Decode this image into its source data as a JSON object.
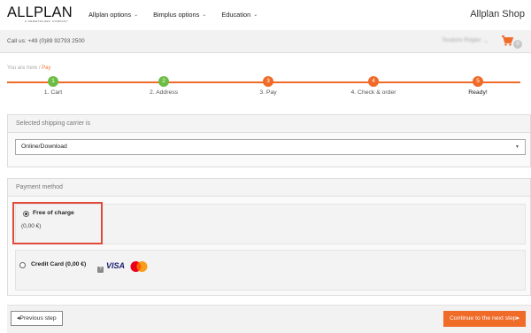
{
  "brand": {
    "logo": "ALLPLAN",
    "logo_sub": "A NEMETSCHEK COMPANY",
    "shop_title": "Allplan Shop"
  },
  "nav": [
    {
      "label": "Allplan options"
    },
    {
      "label": "Bimplus options"
    },
    {
      "label": "Education"
    }
  ],
  "callbar": {
    "call_text": "Call us: +49 (0)89 92793 2500",
    "user_name": "Teodore Rögler",
    "cart_count": "0"
  },
  "breadcrumb": {
    "prefix": "You are here",
    "separator": "/",
    "current": "Pay"
  },
  "steps": [
    {
      "number": "1",
      "label": "1. Cart",
      "state": "done"
    },
    {
      "number": "2",
      "label": "2. Address",
      "state": "done"
    },
    {
      "number": "3",
      "label": "3. Pay",
      "state": "active"
    },
    {
      "number": "4",
      "label": "4. Check & order",
      "state": "todo"
    },
    {
      "number": "5",
      "label": "Ready!",
      "state": "todo"
    }
  ],
  "shipping": {
    "header": "Selected shipping carrier is",
    "selected_value": "Online/Download"
  },
  "payment": {
    "header": "Payment method",
    "options": [
      {
        "label": "Free of charge",
        "price": "(0,00 €)",
        "checked": true
      },
      {
        "label": "Credit Card (0,00 €)",
        "checked": false,
        "card_brand": "VISA"
      }
    ]
  },
  "footer": {
    "prev_label": "Previous step",
    "next_label": "Continue to the next step"
  },
  "colors": {
    "accent": "#f06a28",
    "green": "#6cbd45",
    "highlight": "#e04a3a"
  }
}
